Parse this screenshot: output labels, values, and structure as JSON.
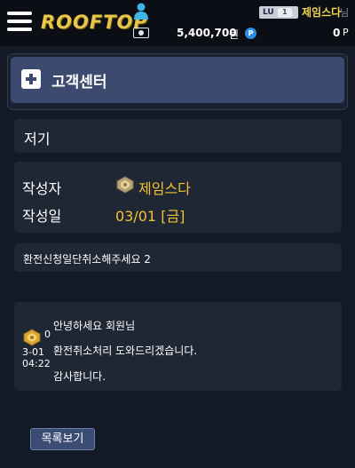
{
  "header": {
    "logo_text": "ROOFTOP",
    "level_label": "LU",
    "level_value": "1",
    "nickname": "제임스다",
    "nickname_suffix": "님",
    "money": "5,400,700",
    "money_unit": "원",
    "point_badge": "P",
    "points": "0",
    "points_unit": "P"
  },
  "section": {
    "title": "고객센터"
  },
  "post": {
    "title": "저기",
    "author_label": "작성자",
    "author": "제임스다",
    "date_label": "작성일",
    "date": "03/01 [금]",
    "subject": "환전신청일단취소해주세요 2"
  },
  "reply": {
    "count": "0",
    "date": "3-01",
    "time": "04:22",
    "lines": [
      "안녕하세요 회원님",
      "환전취소처리 도와드리겠습니다.",
      "감사합니다."
    ]
  },
  "actions": {
    "list_label": "목록보기"
  },
  "colors": {
    "accent_gold": "#f1c232",
    "panel": "#1f2634",
    "section_header": "#3b4a6e",
    "background": "#141a25"
  }
}
